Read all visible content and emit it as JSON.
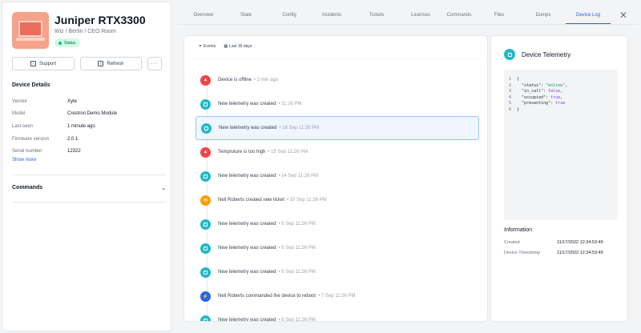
{
  "device": {
    "title": "Juniper RTX3300",
    "subtitle": "Wiz / Berlin / CEO Room",
    "status": "Status"
  },
  "actions": {
    "support": "Support",
    "refresh": "Refresh",
    "more": "···"
  },
  "details": {
    "title": "Device Details",
    "rows": [
      {
        "label": "Vendor",
        "value": "Xyte"
      },
      {
        "label": "Model",
        "value": "Crestron Demo Module"
      },
      {
        "label": "Last seen",
        "value": "1 minute ago"
      },
      {
        "label": "Firmware version",
        "value": "2.0.1"
      },
      {
        "label": "Serial number",
        "value": "12322"
      }
    ],
    "show_more": "Show more"
  },
  "commands": {
    "title": "Commands"
  },
  "tabs": [
    {
      "label": "Overview"
    },
    {
      "label": "State"
    },
    {
      "label": "Config"
    },
    {
      "label": "Incidents"
    },
    {
      "label": "Tickets"
    },
    {
      "label": "Licenses"
    },
    {
      "label": "Commands"
    },
    {
      "label": "Files"
    },
    {
      "label": "Dumps"
    },
    {
      "label": "Device Log"
    }
  ],
  "active_tab": "Device Log",
  "filters": {
    "events": "Events",
    "range": "Last 30 days"
  },
  "events": [
    {
      "icon": "warning-icon",
      "color": "red",
      "text": "Device is offline",
      "time": "2 min ago"
    },
    {
      "icon": "telemetry-icon",
      "color": "teal",
      "text": "New telemetry was created",
      "time": "11:26 PM"
    },
    {
      "icon": "telemetry-icon",
      "color": "teal",
      "text": "New telemetry was created",
      "time": "18 Sep  11:26 PM",
      "selected": true
    },
    {
      "icon": "warning-icon",
      "color": "red",
      "text": "Tempruture is too high",
      "time": "15 Sep  11:26 PM"
    },
    {
      "icon": "telemetry-icon",
      "color": "teal",
      "text": "New telemetry was created",
      "time": "14 Sep  11:26 PM"
    },
    {
      "icon": "ticket-icon",
      "color": "orange",
      "text": "Neil Roberts created new ticket",
      "time": "10 Sep  11:26 PM"
    },
    {
      "icon": "telemetry-icon",
      "color": "teal",
      "text": "New telemetry was created",
      "time": "9 Sep  11:26 PM"
    },
    {
      "icon": "telemetry-icon",
      "color": "teal",
      "text": "New telemetry was created",
      "time": "9 Sep  11:26 PM"
    },
    {
      "icon": "telemetry-icon",
      "color": "teal",
      "text": "New telemetry was created",
      "time": "9 Sep  11:26 PM"
    },
    {
      "icon": "command-icon",
      "color": "blue",
      "text": "Neil Roberts commanded the device to reboot",
      "time": "7 Sep  11:26 PM"
    },
    {
      "icon": "telemetry-icon",
      "color": "teal",
      "text": "New telemetry was created",
      "time": "6 Sep  11:26 PM"
    }
  ],
  "telemetry": {
    "title": "Device Telemetry",
    "code": [
      {
        "n": "1",
        "text": "{"
      },
      {
        "n": "2",
        "key": "  \"status\": ",
        "val": "\"online\"",
        "type": "str",
        "end": ","
      },
      {
        "n": "3",
        "key": "  \"in_call\": ",
        "val": "false",
        "type": "kw",
        "end": ","
      },
      {
        "n": "4",
        "key": "  \"occupied\": ",
        "val": "true",
        "type": "kw",
        "end": ","
      },
      {
        "n": "5",
        "key": "  \"presenting\": ",
        "val": "true",
        "type": "kw",
        "end": ""
      },
      {
        "n": "6",
        "text": "}"
      }
    ],
    "info_title": "Information",
    "info": [
      {
        "label": "Created",
        "value": "11/17/2022 12:34:53:49"
      },
      {
        "label": "Device Timestamp",
        "value": "11/17/2022 12:34:53:49"
      }
    ]
  },
  "colors": {
    "accent": "#2563eb",
    "teal": "#22b8c6",
    "red": "#ef4444",
    "orange": "#f59e0b",
    "blue": "#2563eb"
  }
}
